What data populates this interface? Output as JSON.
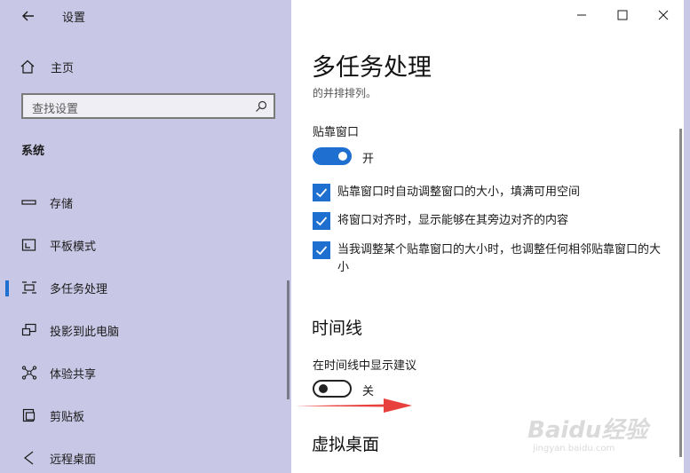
{
  "window": {
    "app_title": "设置",
    "caption_buttons": [
      "minimize-icon",
      "maximize-icon",
      "close-icon"
    ]
  },
  "sidebar": {
    "home_label": "主页",
    "search_placeholder": "查找设置",
    "section_label": "系统",
    "items": [
      {
        "label": "存储",
        "icon": "storage-icon"
      },
      {
        "label": "平板模式",
        "icon": "tablet-mode-icon"
      },
      {
        "label": "多任务处理",
        "icon": "multitasking-icon",
        "selected": true
      },
      {
        "label": "投影到此电脑",
        "icon": "projecting-icon"
      },
      {
        "label": "体验共享",
        "icon": "shared-experiences-icon"
      },
      {
        "label": "剪贴板",
        "icon": "clipboard-icon"
      },
      {
        "label": "远程桌面",
        "icon": "remote-desktop-icon"
      }
    ]
  },
  "main": {
    "page_title": "多任务处理",
    "subtitle": "的并排排列。",
    "snap": {
      "label": "贴靠窗口",
      "toggle_on": true,
      "toggle_state": "开",
      "options": [
        {
          "label": "贴靠窗口时自动调整窗口的大小，填满可用空间",
          "checked": true
        },
        {
          "label": "将窗口对齐时，显示能够在其旁边对齐的内容",
          "checked": true
        },
        {
          "label": "当我调整某个贴靠窗口的大小时，也调整任何相邻贴靠窗口的大小",
          "checked": true
        }
      ]
    },
    "timeline": {
      "heading": "时间线",
      "suggestion_label": "在时间线中显示建议",
      "toggle_on": false,
      "toggle_state": "关"
    },
    "virtual_desktops_heading": "虚拟桌面"
  },
  "watermark": {
    "main": "Baidu经验",
    "sub": "jingyan.baidu.com"
  },
  "colors": {
    "sidebar_bg": "#c8c8e6",
    "accent": "#1f6fd1",
    "arrow": "#e8403c"
  }
}
